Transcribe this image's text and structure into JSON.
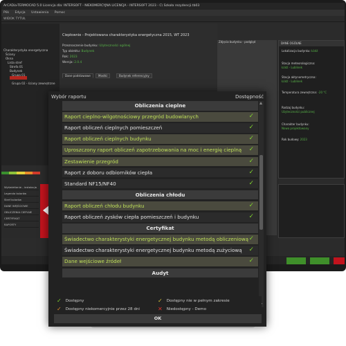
{
  "app": {
    "title_bar": "ArCADia-TERMOCAD 5.0 Licencja dla: INTERSOFT - NIEKOMERCYJNA LICENCJA - INTERSOFT 2023 - C\\ Szkoła rezydencji.tb03",
    "menu": [
      "Plik",
      "Edycja",
      "Ustawienia",
      "Pomoc"
    ],
    "subbar": "WIDOK TYTUŁ"
  },
  "tree": {
    "items": [
      "Charakterystyka energetyczna",
      "Ściany",
      "Okna",
      "Lista stref",
      "Strefa 01",
      "Budynek",
      "Grupa 01",
      "Grupa 02 - ściany zewnętrzne"
    ]
  },
  "form": {
    "title": "Ciepłownie - Projektowana charakterystyka energetyczna 2015, WT 2023",
    "rows": [
      {
        "label": "Przeznaczenie budynku:",
        "value": "Użyteczności ogólnej"
      },
      {
        "label": "Typ obiektu:",
        "value": "Budynek"
      },
      {
        "label": "Rok:",
        "value": "2023"
      },
      {
        "label": "Wersja:",
        "value": "2.0.4"
      }
    ],
    "tabs": [
      "Dane podstawowe",
      "Mostki",
      "Budynek referencyjny"
    ]
  },
  "center_block": {
    "header": "Zdjęcia budynku - podgląd"
  },
  "info_panel": {
    "header": "DANE OGÓLNE",
    "rows": [
      {
        "label": "Lokalizacja budynku:",
        "value": "Łódź"
      },
      {
        "label": "Stacja meteorologiczna:",
        "value": "Łódź - Lublinek"
      },
      {
        "label": "Stacja aktynometryczna:",
        "value": "Łódź - Lublinek"
      },
      {
        "label": "Temperatura zewnętrzna:",
        "value": "-20 °C"
      },
      {
        "label": "Rodzaj budynku:",
        "value": "Użyteczności publicznej"
      },
      {
        "label": "Charakter budynku:",
        "value": "Nowo projektowany"
      },
      {
        "label": "Rok budowy:",
        "value": "2023"
      }
    ]
  },
  "left_tools": {
    "items": [
      "Wyświetlanie - instalacja",
      "Legenda kolorów",
      "Stref kolorów",
      "DANE WEJŚCIOWE",
      "OBLICZENIA CIEPLNE",
      "CERTYFIKAT",
      "RAPORTY"
    ]
  },
  "dialog": {
    "title": "Wybór raportu",
    "availability_label": "Dostępność",
    "sections": [
      {
        "header": "Obliczenia cieplne",
        "items": [
          {
            "label": "Raport cieplno-wilgotnościowy przegród budowlanych",
            "hl": true
          },
          {
            "label": "Raport obliczeń cieplnych pomieszczeń",
            "hl": false
          },
          {
            "label": "Raport obliczeń cieplnych budynku",
            "hl": true
          },
          {
            "label": "Uproszczony raport obliczeń zapotrzebowania na moc i energię cieplną",
            "hl": true
          },
          {
            "label": "Zestawienie przegród",
            "hl": true
          },
          {
            "label": "Raport z doboru odbiorników ciepła",
            "hl": false
          },
          {
            "label": "Standard NF15/NF40",
            "hl": false
          }
        ]
      },
      {
        "header": "Obliczenia chłodu",
        "items": [
          {
            "label": "Raport obliczeń chłodu budynku",
            "hl": true
          },
          {
            "label": "Raport obliczeń zysków ciepła pomieszczeń i budynku",
            "hl": false
          }
        ]
      },
      {
        "header": "Certyfikat",
        "items": [
          {
            "label": "Świadectwo charakterystyki energetycznej budynku metodą obliczeniową",
            "hl": true
          },
          {
            "label": "Świadectwo charakterystyki energetycznej budynku metodą zużyciową",
            "hl": false
          },
          {
            "label": "Dane wejściowe źródeł",
            "hl": true
          }
        ]
      },
      {
        "header": "Audyt",
        "items": []
      }
    ],
    "legend": {
      "available": "Dostępny",
      "partial": "Dostępny nie w pełnym zakresie",
      "noncommercial": "Dostępny niekomercyjnie przez 28 dni",
      "unavailable": "Niedostępny - Demo"
    },
    "ok_label": "OK"
  },
  "colors": {
    "accent_green": "#7fd32e",
    "highlight_text": "#bfe05a",
    "brand_red": "#c2131d",
    "dialog_bg": "#222222"
  }
}
